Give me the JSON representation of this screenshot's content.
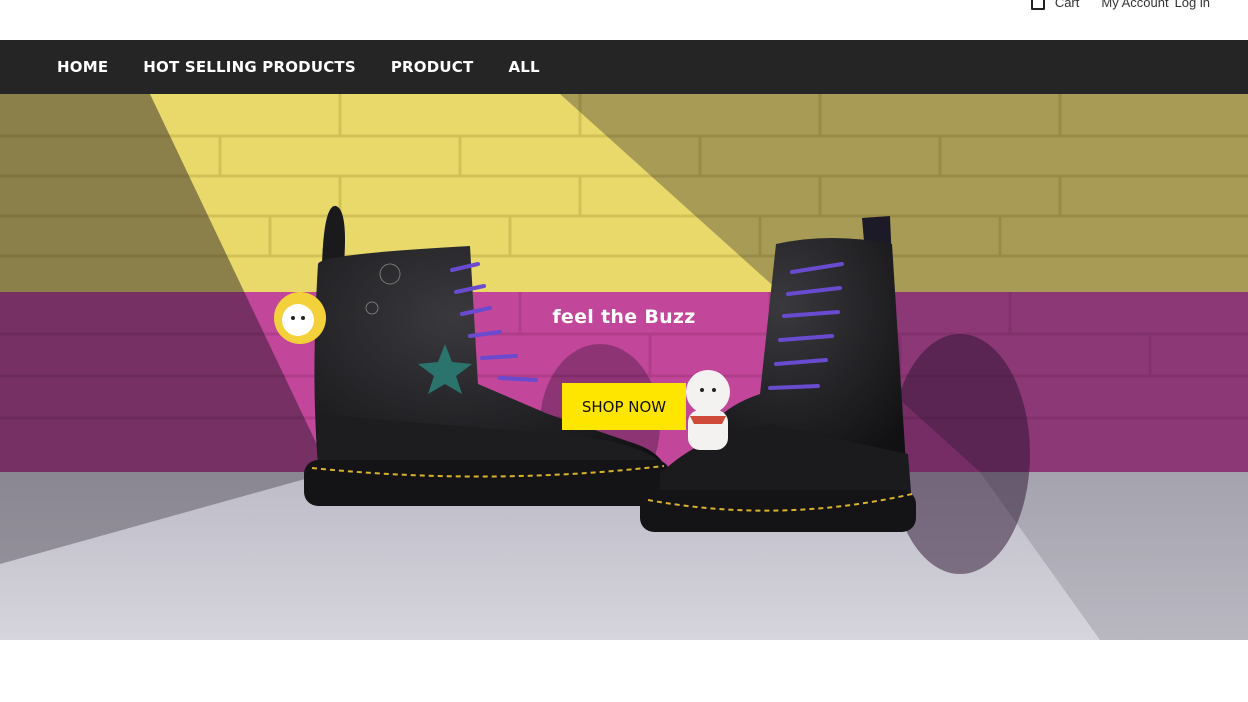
{
  "topbar": {
    "cart_label": "Cart",
    "account_label": "My Account",
    "login_label": "Log in"
  },
  "nav": {
    "items": [
      {
        "label": "HOME"
      },
      {
        "label": "HOT SELLING PRODUCTS"
      },
      {
        "label": "PRODUCT"
      },
      {
        "label": "ALL"
      }
    ]
  },
  "hero": {
    "headline": "feel the Buzz",
    "cta_label": "SHOP NOW"
  },
  "colors": {
    "nav_background": "#252525",
    "cta_background": "#ffe600",
    "wall_yellow": "#e9d96a",
    "wall_pink": "#c2479a"
  },
  "icons": {
    "cart": "shopping-bag-icon"
  }
}
